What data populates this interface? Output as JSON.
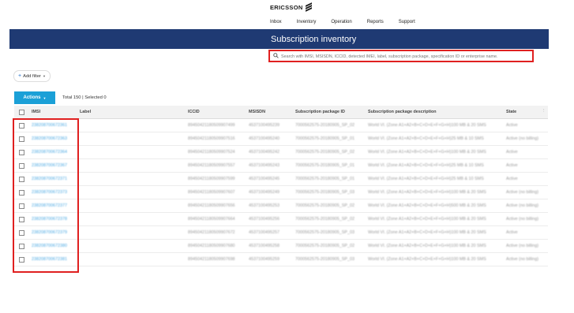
{
  "header": {
    "brand": "ERICSSON",
    "nav": [
      "Inbox",
      "Inventory",
      "Operation",
      "Reports",
      "Support"
    ]
  },
  "banner": {
    "title": "Subscription inventory"
  },
  "search": {
    "placeholder": "Search with IMSI, MSISDN, ICCID, detected IMEI, label, subscription package, specification ID or enterprise name."
  },
  "filter": {
    "label": "Add filter"
  },
  "toolbar": {
    "actions_label": "Actions",
    "total_text": "Total 150 | Selected 0"
  },
  "table": {
    "columns": [
      "IMSI",
      "Label",
      "ICCID",
      "MSISDN",
      "Subscription package ID",
      "Subscription package description",
      "State"
    ],
    "rows": [
      {
        "imsi": "238208700672361",
        "label": "",
        "iccid": "89450421180509907499",
        "msisdn": "4537100495239",
        "package_id": "7000562575-20180905_SP_02",
        "package_desc": "World VI. (Zone A1+A2+B+C+D+E+F+G+H)100 MB & 20 SMS",
        "state": "Active"
      },
      {
        "imsi": "238208700672363",
        "label": "",
        "iccid": "89450421180509907516",
        "msisdn": "4537100495240",
        "package_id": "7000562575-20180905_SP_01",
        "package_desc": "World VI. (Zone A1+A2+B+C+D+E+F+G+H)25 MB & 10 SMS",
        "state": "Active (no billing)"
      },
      {
        "imsi": "238208700672364",
        "label": "",
        "iccid": "89450421180509907524",
        "msisdn": "4537100495242",
        "package_id": "7000562575-20180905_SP_02",
        "package_desc": "World VI. (Zone A1+A2+B+C+D+E+F+G+H)100 MB & 20 SMS",
        "state": "Active"
      },
      {
        "imsi": "238208700672367",
        "label": "",
        "iccid": "89450421180509907557",
        "msisdn": "4537100495243",
        "package_id": "7000562575-20180905_SP_01",
        "package_desc": "World VI. (Zone A1+A2+B+C+D+E+F+G+H)25 MB & 10 SMS",
        "state": "Active"
      },
      {
        "imsi": "238208700672371",
        "label": "",
        "iccid": "89450421180509907599",
        "msisdn": "4537100495245",
        "package_id": "7000562575-20180905_SP_01",
        "package_desc": "World VI. (Zone A1+A2+B+C+D+E+F+G+H)25 MB & 10 SMS",
        "state": "Active"
      },
      {
        "imsi": "238208700672373",
        "label": "",
        "iccid": "89450421180509907607",
        "msisdn": "4537100495249",
        "package_id": "7000562575-20180905_SP_03",
        "package_desc": "World VI. (Zone A1+A2+B+C+D+E+F+G+H)100 MB & 20 SMS",
        "state": "Active (no billing)"
      },
      {
        "imsi": "238208700672377",
        "label": "",
        "iccid": "89450421180509907656",
        "msisdn": "4537100495253",
        "package_id": "7000562575-20180905_SP_02",
        "package_desc": "World VI. (Zone A1+A2+B+C+D+E+F+G+H)500 MB & 20 SMS",
        "state": "Active (no billing)"
      },
      {
        "imsi": "238208700672378",
        "label": "",
        "iccid": "89450421180509907664",
        "msisdn": "4537100495256",
        "package_id": "7000562575-20180905_SP_02",
        "package_desc": "World VI. (Zone A1+A2+B+C+D+E+F+G+H)100 MB & 20 SMS",
        "state": "Active (no billing)"
      },
      {
        "imsi": "238208700672379",
        "label": "",
        "iccid": "89450421180509907672",
        "msisdn": "4537100495257",
        "package_id": "7000562575-20180905_SP_03",
        "package_desc": "World VI. (Zone A1+A2+B+C+D+E+F+G+H)100 MB & 20 SMS",
        "state": "Active"
      },
      {
        "imsi": "238208700672380",
        "label": "",
        "iccid": "89450421180509907680",
        "msisdn": "4537100495258",
        "package_id": "7000562575-20180905_SP_02",
        "package_desc": "World VI. (Zone A1+A2+B+C+D+E+F+G+H)100 MB & 20 SMS",
        "state": "Active (no billing)"
      },
      {
        "imsi": "238208700672381",
        "label": "",
        "iccid": "89450421180509907698",
        "msisdn": "4537100495259",
        "package_id": "7000562575-20180905_SP_03",
        "package_desc": "World VI. (Zone A1+A2+B+C+D+E+F+G+H)100 MB & 20 SMS",
        "state": "Active (no billing)"
      }
    ]
  },
  "colors": {
    "banner": "#1f3a73",
    "accent": "#1ba0d7",
    "highlight": "#e02020",
    "link": "#4aa8e2"
  }
}
